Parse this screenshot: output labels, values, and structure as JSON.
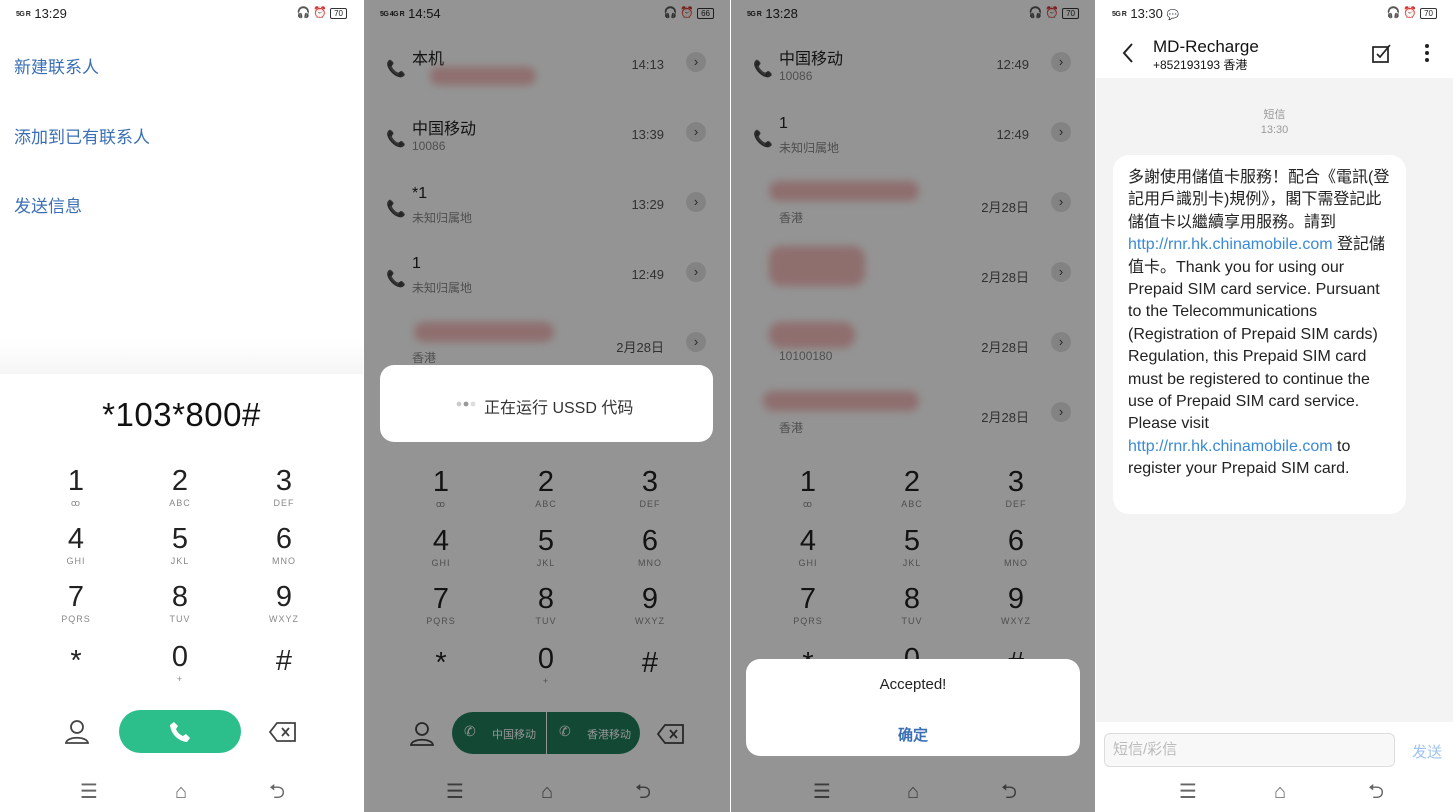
{
  "p1": {
    "status": {
      "signal": "5G R",
      "time": "13:29",
      "battery": "70"
    },
    "menu": [
      "新建联系人",
      "添加到已有联系人",
      "发送信息"
    ],
    "dialed": "*103*800#"
  },
  "keypad": {
    "keys": [
      {
        "d": "1",
        "l": "ꝏ"
      },
      {
        "d": "2",
        "l": "ABC"
      },
      {
        "d": "3",
        "l": "DEF"
      },
      {
        "d": "4",
        "l": "GHI"
      },
      {
        "d": "5",
        "l": "JKL"
      },
      {
        "d": "6",
        "l": "MNO"
      },
      {
        "d": "7",
        "l": "PQRS"
      },
      {
        "d": "8",
        "l": "TUV"
      },
      {
        "d": "9",
        "l": "WXYZ"
      },
      {
        "d": "*",
        "l": ""
      },
      {
        "d": "0",
        "l": "+"
      },
      {
        "d": "#",
        "l": ""
      }
    ]
  },
  "p2": {
    "status": {
      "signal": "5G 4G R",
      "time": "14:54",
      "battery": "66"
    },
    "calls": [
      {
        "name": "本机",
        "sub": "",
        "time": "14:13"
      },
      {
        "name": "中国移动",
        "sub": "10086",
        "time": "13:39"
      },
      {
        "name": "*1",
        "sub": "未知归属地",
        "time": "13:29"
      },
      {
        "name": "1",
        "sub": "未知归属地",
        "time": "12:49"
      },
      {
        "name": "",
        "sub": "香港",
        "time": "2月28日"
      }
    ],
    "ussd_text": "正在运行 USSD 代码",
    "sim1": "中国移动",
    "sim2": "香港移动"
  },
  "p3": {
    "status": {
      "signal": "5G R",
      "time": "13:28",
      "battery": "70"
    },
    "calls": [
      {
        "name": "中国移动",
        "sub": "10086",
        "time": "12:49"
      },
      {
        "name": "1",
        "sub": "未知归属地",
        "time": "12:49"
      },
      {
        "name": "",
        "sub": "香港",
        "time": "2月28日"
      },
      {
        "name": "",
        "sub": "",
        "time": "2月28日"
      },
      {
        "name": "",
        "sub": "10100180",
        "time": "2月28日"
      },
      {
        "name": "",
        "sub": "香港",
        "time": "2月28日"
      }
    ],
    "dialog_msg": "Accepted!",
    "dialog_ok": "确定"
  },
  "p4": {
    "status": {
      "signal": "5G R",
      "time": "13:30",
      "battery": "70"
    },
    "title": "MD-Recharge",
    "phone": "+852193193 香港",
    "meta_type": "短信",
    "meta_time": "13:30",
    "msg_1": "多謝使用儲值卡服務！配合《電訊(登記用戶識別卡)規例》，閣下需登記此儲值卡以繼續享用服務。請到 ",
    "link_1": "http://rnr.hk.chinamobile.com",
    "msg_2": " 登記儲值卡。Thank you for using our Prepaid SIM card service. Pursuant to the Telecommunications (Registration of Prepaid SIM cards) Regulation, this Prepaid SIM card must be registered to continue the use of Prepaid SIM card service. Please visit ",
    "link_2": "http://rnr.hk.chinamobile.com",
    "msg_3": " to register your Prepaid SIM card.",
    "input_placeholder": "短信/彩信",
    "send_label": "发送"
  },
  "colors": {
    "accent_blue": "#3a6fb5",
    "call_green": "#2dbf8b",
    "link_blue": "#3a8ad6"
  }
}
